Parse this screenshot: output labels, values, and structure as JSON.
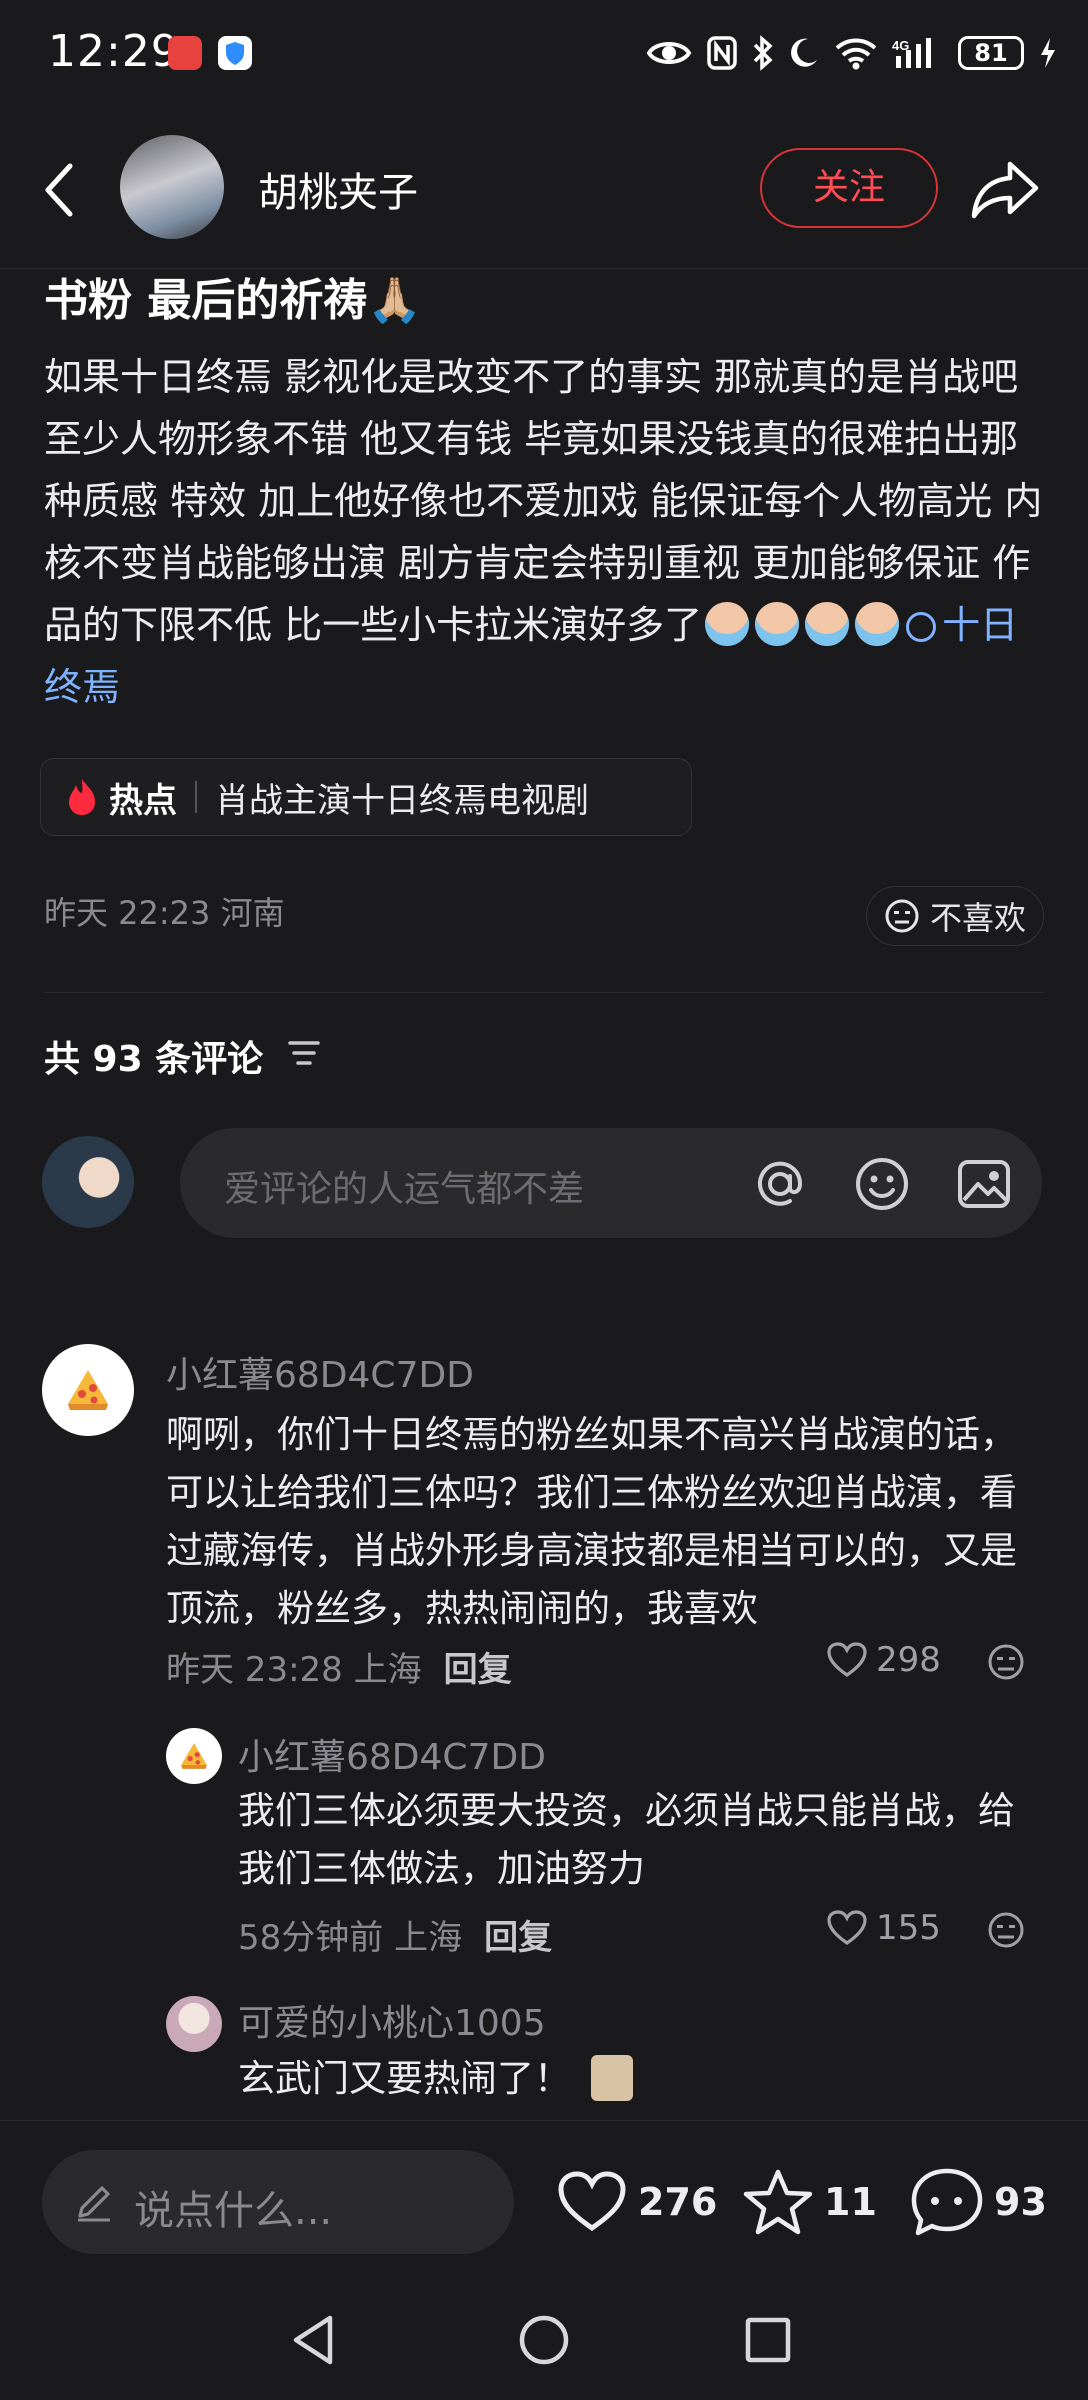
{
  "status_bar": {
    "time": "12:29",
    "battery": "81"
  },
  "header": {
    "author": "胡桃夹子",
    "follow_label": "关注"
  },
  "post": {
    "title": "书粉 最后的祈祷🙏🏼",
    "body": "如果十日终焉 影视化是改变不了的事实 那就真的是肖战吧 至少人物形象不错 他又有钱 毕竟如果没钱真的很难拍出那种质感 特效 加上他好像也不爱加戏 能保证每个人物高光 内核不变肖战能够出演 剧方肯定会特别重视 更加能够保证 作品的下限不低 比一些小卡拉米演好多了",
    "emoji_name": "crying-icon",
    "hashtag": "十日终焉",
    "hot_label": "热点",
    "hot_text": "肖战主演十日终焉电视剧",
    "meta": "昨天 22:23 河南",
    "dislike_label": "不喜欢"
  },
  "comments_section": {
    "count_label": "共 93 条评论",
    "input_placeholder": "爱评论的人运气都不差"
  },
  "comments": [
    {
      "name": "小红薯68D4C7DD",
      "text": "啊咧，你们十日终焉的粉丝如果不高兴肖战演的话，可以让给我们三体吗？我们三体粉丝欢迎肖战演，看过藏海传，肖战外形身高演技都是相当可以的，又是顶流，粉丝多，热热闹闹的，我喜欢",
      "time": "昨天 23:28 上海",
      "reply_label": "回复",
      "likes": "298"
    },
    {
      "name": "小红薯68D4C7DD",
      "text": "我们三体必须要大投资，必须肖战只能肖战，给我们三体做法，加油努力",
      "time": "58分钟前 上海",
      "reply_label": "回复",
      "likes": "155"
    },
    {
      "name": "可爱的小桃心1005",
      "text": "玄武门又要热闹了！"
    }
  ],
  "bottom_bar": {
    "placeholder": "说点什么...",
    "likes": "276",
    "stars": "11",
    "comments": "93"
  },
  "colors": {
    "accent": "#ff4d55",
    "hashtag": "#7fb2ff",
    "background": "#1a1a1c"
  }
}
